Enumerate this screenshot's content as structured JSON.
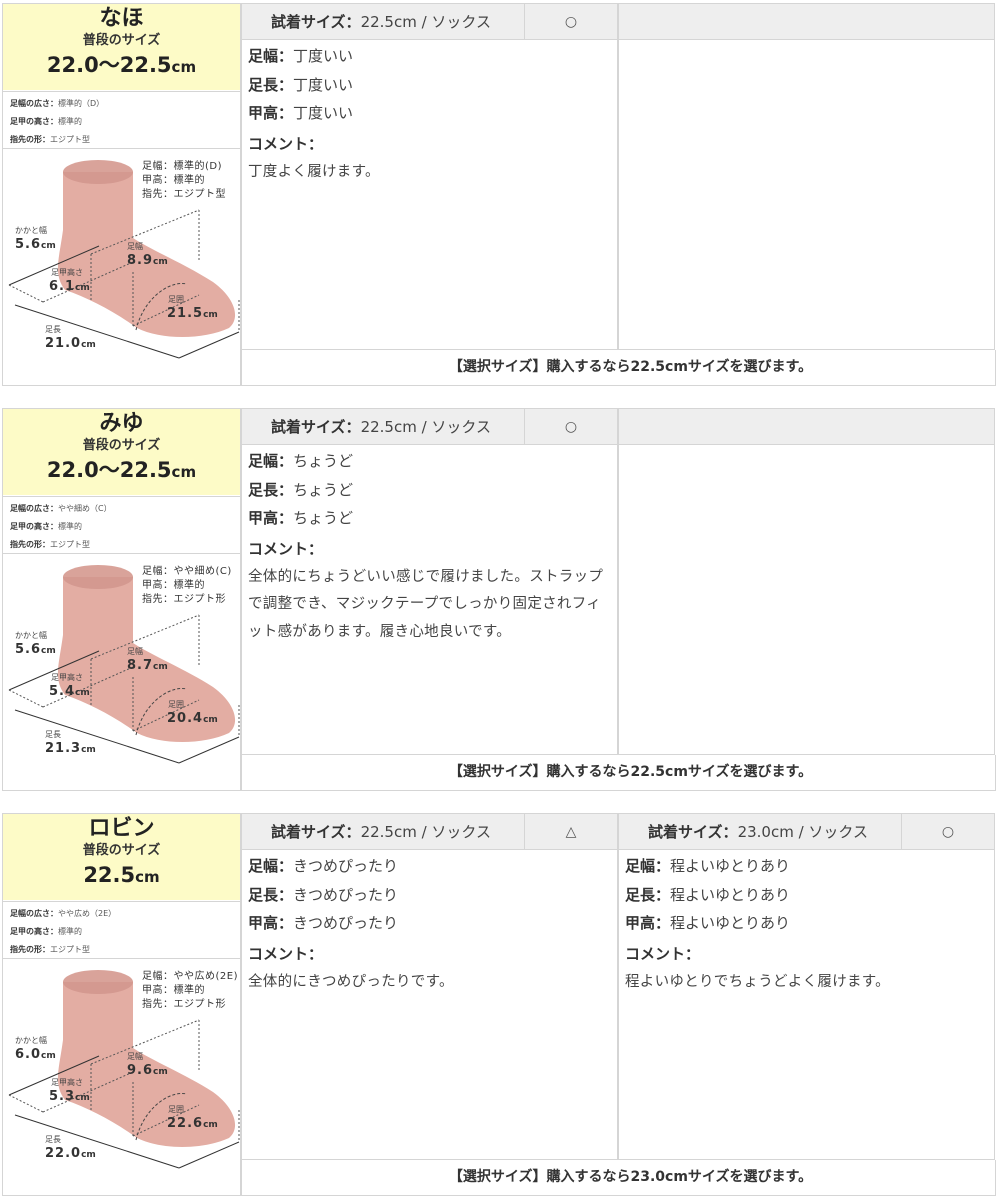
{
  "labels": {
    "usual_size": "普段のサイズ",
    "width_attr": "足幅の広さ：",
    "instep_attr": "足甲の高さ：",
    "toe_attr": "指先の形：",
    "heel_width": "かかと幅",
    "foot_width": "足幅",
    "instep_height": "足甲高さ",
    "girth": "足囲",
    "length": "足長",
    "unit": "cm",
    "trial_size": "試着サイズ：",
    "fit_width": "足幅：",
    "fit_length": "足長：",
    "fit_instep": "甲高：",
    "comment": "コメント："
  },
  "reviews": [
    {
      "name": "なほ",
      "usual_size": "22.0〜22.5",
      "attrs": {
        "width": "標準的（D）",
        "instep": "標準的",
        "toe": "エジプト型"
      },
      "summary": [
        "足幅：標準的(D)",
        "甲高：標準的",
        "指先：エジプト型"
      ],
      "measure": {
        "heel": "5.6",
        "width": "8.9",
        "instep": "6.1",
        "girth": "21.5",
        "length": "21.0"
      },
      "trials": [
        {
          "size": "22.5cm / ソックス",
          "mark": "○",
          "width": "丁度いい",
          "length": "丁度いい",
          "instep": "丁度いい",
          "comment": "丁度よく履けます。"
        },
        {
          "size": "",
          "mark": "",
          "width": "",
          "length": "",
          "instep": "",
          "comment": ""
        }
      ],
      "verdict": "【選択サイズ】購入するなら22.5cmサイズを選びます。"
    },
    {
      "name": "みゆ",
      "usual_size": "22.0〜22.5",
      "attrs": {
        "width": "やや細め（C）",
        "instep": "標準的",
        "toe": "エジプト型"
      },
      "summary": [
        "足幅：やや細め(C)",
        "甲高：標準的",
        "指先：エジプト形"
      ],
      "measure": {
        "heel": "5.6",
        "width": "8.7",
        "instep": "5.4",
        "girth": "20.4",
        "length": "21.3"
      },
      "trials": [
        {
          "size": "22.5cm / ソックス",
          "mark": "○",
          "width": "ちょうど",
          "length": "ちょうど",
          "instep": "ちょうど",
          "comment": "全体的にちょうどいい感じで履けました。ストラップで調整でき、マジックテープでしっかり固定されフィット感があります。履き心地良いです。"
        },
        {
          "size": "",
          "mark": "",
          "width": "",
          "length": "",
          "instep": "",
          "comment": ""
        }
      ],
      "verdict": "【選択サイズ】購入するなら22.5cmサイズを選びます。"
    },
    {
      "name": "ロビン",
      "usual_size": "22.5",
      "attrs": {
        "width": "やや広め（2E）",
        "instep": "標準的",
        "toe": "エジプト型"
      },
      "summary": [
        "足幅：やや広め(2E)",
        "甲高：標準的",
        "指先：エジプト形"
      ],
      "measure": {
        "heel": "6.0",
        "width": "9.6",
        "instep": "5.3",
        "girth": "22.6",
        "length": "22.0"
      },
      "trials": [
        {
          "size": "22.5cm / ソックス",
          "mark": "△",
          "width": "きつめぴったり",
          "length": "きつめぴったり",
          "instep": "きつめぴったり",
          "comment": "全体的にきつめぴったりです。"
        },
        {
          "size": "23.0cm / ソックス",
          "mark": "○",
          "width": "程よいゆとりあり",
          "length": "程よいゆとりあり",
          "instep": "程よいゆとりあり",
          "comment": "程よいゆとりでちょうどよく履けます。"
        }
      ],
      "verdict": "【選択サイズ】購入するなら23.0cmサイズを選びます。"
    }
  ]
}
